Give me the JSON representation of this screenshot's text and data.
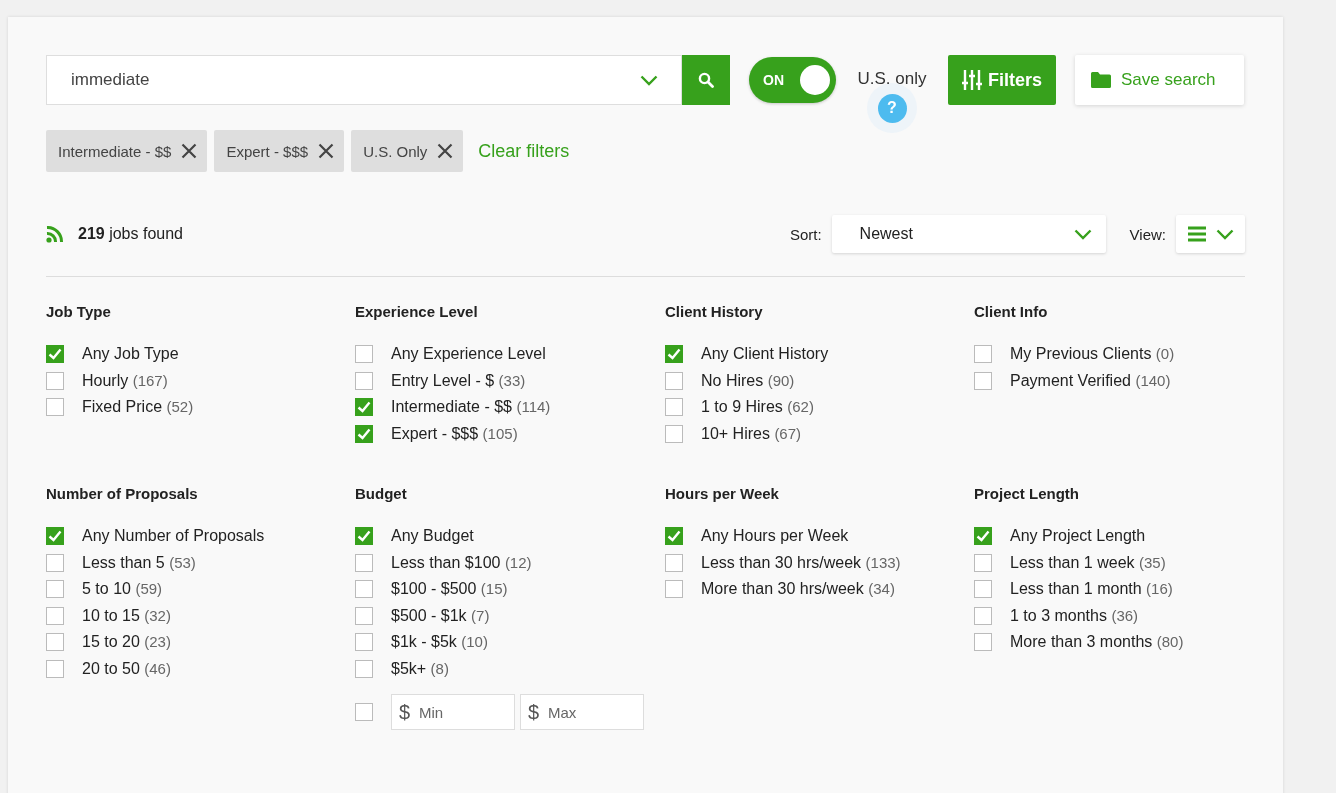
{
  "search": {
    "value": "immediate"
  },
  "us_only": {
    "on": true,
    "toggle_label": "ON",
    "label": "U.S. only",
    "help": "?"
  },
  "filters_button": "Filters",
  "save_search_button": "Save search",
  "chips": [
    {
      "label": "Intermediate - $$"
    },
    {
      "label": "Expert - $$$"
    },
    {
      "label": "U.S. Only"
    }
  ],
  "clear_filters": "Clear filters",
  "results": {
    "count": "219",
    "text": "jobs found"
  },
  "sort": {
    "label": "Sort:",
    "value": "Newest"
  },
  "view": {
    "label": "View:"
  },
  "groups": [
    {
      "title": "Job Type",
      "items": [
        {
          "label": "Any Job Type",
          "checked": true
        },
        {
          "label": "Hourly",
          "count": "(167)",
          "checked": false
        },
        {
          "label": "Fixed Price",
          "count": "(52)",
          "checked": false
        }
      ]
    },
    {
      "title": "Experience Level",
      "items": [
        {
          "label": "Any Experience Level",
          "checked": false
        },
        {
          "label": "Entry Level - $",
          "count": "(33)",
          "checked": false
        },
        {
          "label": "Intermediate - $$",
          "count": "(114)",
          "checked": true
        },
        {
          "label": "Expert - $$$",
          "count": "(105)",
          "checked": true
        }
      ]
    },
    {
      "title": "Client History",
      "items": [
        {
          "label": "Any Client History",
          "checked": true
        },
        {
          "label": "No Hires",
          "count": "(90)",
          "checked": false
        },
        {
          "label": "1 to 9 Hires",
          "count": "(62)",
          "checked": false
        },
        {
          "label": "10+ Hires",
          "count": "(67)",
          "checked": false
        }
      ]
    },
    {
      "title": "Client Info",
      "items": [
        {
          "label": "My Previous Clients",
          "count": "(0)",
          "checked": false
        },
        {
          "label": "Payment Verified",
          "count": "(140)",
          "checked": false
        }
      ]
    },
    {
      "title": "Number of Proposals",
      "items": [
        {
          "label": "Any Number of Proposals",
          "checked": true
        },
        {
          "label": "Less than 5",
          "count": "(53)",
          "checked": false
        },
        {
          "label": "5 to 10",
          "count": "(59)",
          "checked": false
        },
        {
          "label": "10 to 15",
          "count": "(32)",
          "checked": false
        },
        {
          "label": "15 to 20",
          "count": "(23)",
          "checked": false
        },
        {
          "label": "20 to 50",
          "count": "(46)",
          "checked": false
        }
      ]
    },
    {
      "title": "Budget",
      "items": [
        {
          "label": "Any Budget",
          "checked": true
        },
        {
          "label": "Less than $100",
          "count": "(12)",
          "checked": false
        },
        {
          "label": "$100 - $500",
          "count": "(15)",
          "checked": false
        },
        {
          "label": "$500 - $1k",
          "count": "(7)",
          "checked": false
        },
        {
          "label": "$1k - $5k",
          "count": "(10)",
          "checked": false
        },
        {
          "label": "$5k+",
          "count": "(8)",
          "checked": false
        }
      ],
      "custom_range": {
        "checked": false,
        "currency": "$",
        "min_placeholder": "Min",
        "max_placeholder": "Max"
      }
    },
    {
      "title": "Hours per Week",
      "items": [
        {
          "label": "Any Hours per Week",
          "checked": true
        },
        {
          "label": "Less than 30 hrs/week",
          "count": "(133)",
          "checked": false
        },
        {
          "label": "More than 30 hrs/week",
          "count": "(34)",
          "checked": false
        }
      ]
    },
    {
      "title": "Project Length",
      "items": [
        {
          "label": "Any Project Length",
          "checked": true
        },
        {
          "label": "Less than 1 week",
          "count": "(35)",
          "checked": false
        },
        {
          "label": "Less than 1 month",
          "count": "(16)",
          "checked": false
        },
        {
          "label": "1 to 3 months",
          "count": "(36)",
          "checked": false
        },
        {
          "label": "More than 3 months",
          "count": "(80)",
          "checked": false
        }
      ]
    }
  ]
}
